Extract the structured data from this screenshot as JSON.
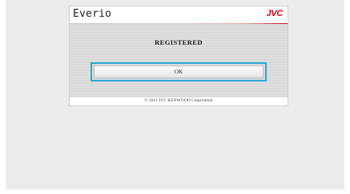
{
  "app": {
    "title": "Everio",
    "brand": "JVC"
  },
  "dialog": {
    "status_text": "REGISTERED",
    "ok_label": "OK"
  },
  "footer": {
    "copyright": "© 2011 JVC KENWOOD Corporation"
  },
  "colors": {
    "brand": "#d0021b",
    "focus_ring": "#29a8d8",
    "background": "#ececec"
  }
}
